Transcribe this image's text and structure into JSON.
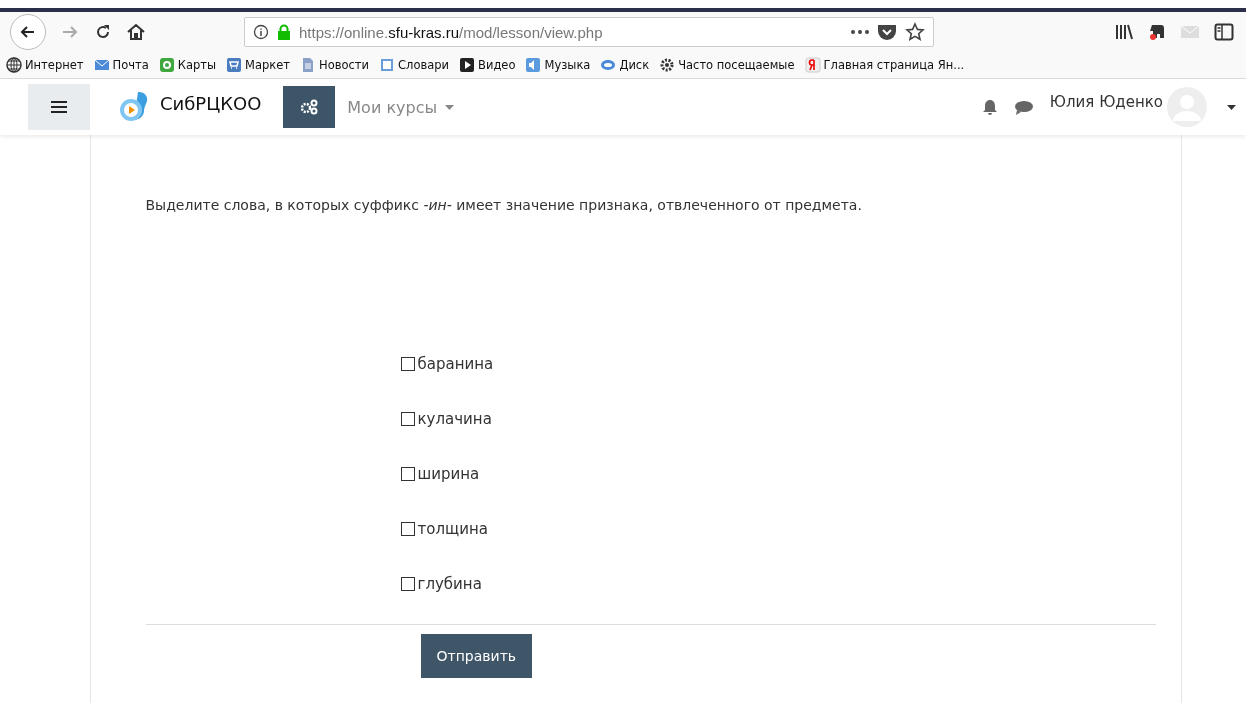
{
  "browser": {
    "url_host_prefix": "https://online.",
    "url_host": "sfu-kras.ru",
    "url_path": "/mod/lesson/view.php"
  },
  "bookmarks": [
    {
      "label": "Интернет",
      "kind": "globe"
    },
    {
      "label": "Почта",
      "kind": "mail"
    },
    {
      "label": "Карты",
      "kind": "maps"
    },
    {
      "label": "Маркет",
      "kind": "market"
    },
    {
      "label": "Новости",
      "kind": "news"
    },
    {
      "label": "Словари",
      "kind": "dict"
    },
    {
      "label": "Видео",
      "kind": "video"
    },
    {
      "label": "Музыка",
      "kind": "music"
    },
    {
      "label": "Диск",
      "kind": "disk"
    },
    {
      "label": "Часто посещаемые",
      "kind": "gear"
    },
    {
      "label": "Главная страница Ян...",
      "kind": "ya"
    }
  ],
  "navbar": {
    "site_name": "СибРЦКОО",
    "menu": "Мои курсы",
    "user": "Юлия Юденко"
  },
  "question": "Выделите слова, в которых суффикс *-ин-*  имеет значение признака, отвлеченного от предмета.",
  "options": [
    {
      "label": "баранина",
      "checked": false
    },
    {
      "label": "кулачина",
      "checked": false
    },
    {
      "label": "ширина",
      "checked": false
    },
    {
      "label": "толщина",
      "checked": false
    },
    {
      "label": "глубина",
      "checked": false
    }
  ],
  "submit": "Отправить"
}
